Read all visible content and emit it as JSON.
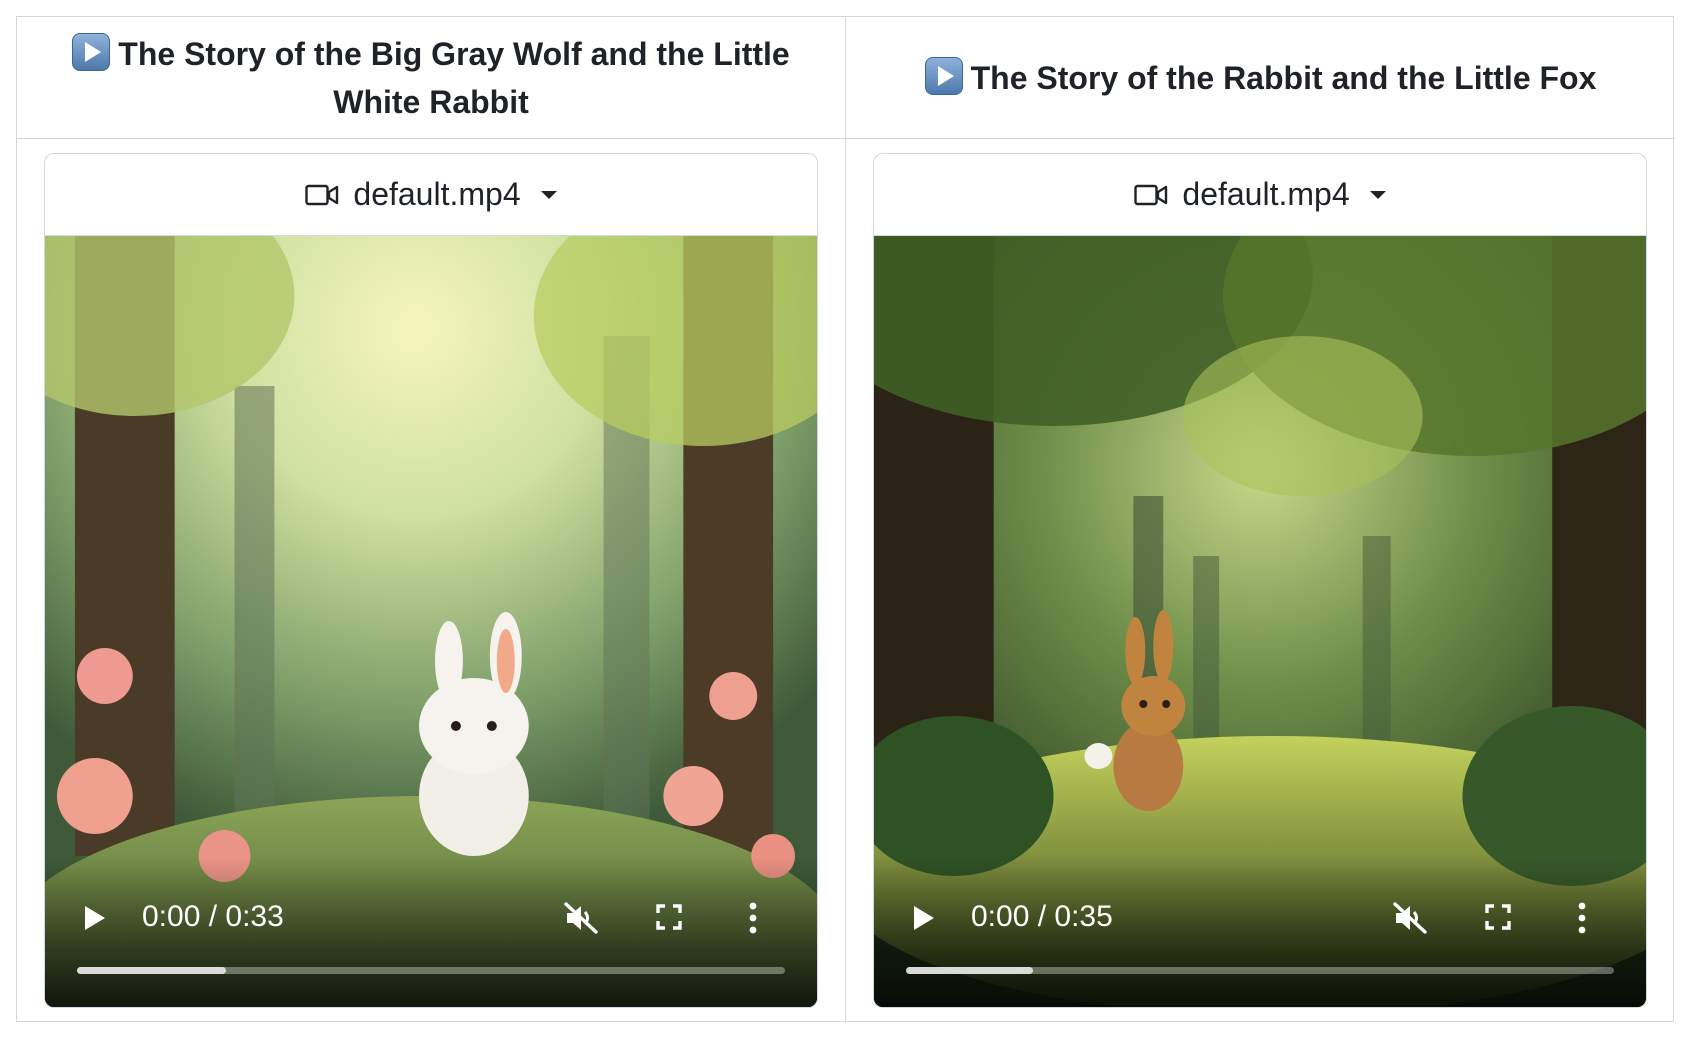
{
  "videos": [
    {
      "title": "The Story of the Big Gray Wolf and the Little White Rabbit",
      "file_name": "default.mp4",
      "time": "0:00 / 0:33",
      "buffered_fraction": 0.21
    },
    {
      "title": "The Story of the Rabbit and the Little Fox",
      "file_name": "default.mp4",
      "time": "0:00 / 0:35",
      "buffered_fraction": 0.18
    }
  ],
  "icons": {
    "title_icon": "play-button-emoji",
    "file_icon": "video-camera-icon",
    "dropdown_icon": "caret-down-icon",
    "play_control": "play-icon",
    "mute_control": "muted-speaker-icon",
    "fullscreen_control": "fullscreen-icon",
    "more_control": "more-vertical-icon"
  },
  "colors": {
    "border": "#d1d9e0",
    "text": "#1f2328",
    "title_icon": "#5b84b6"
  }
}
